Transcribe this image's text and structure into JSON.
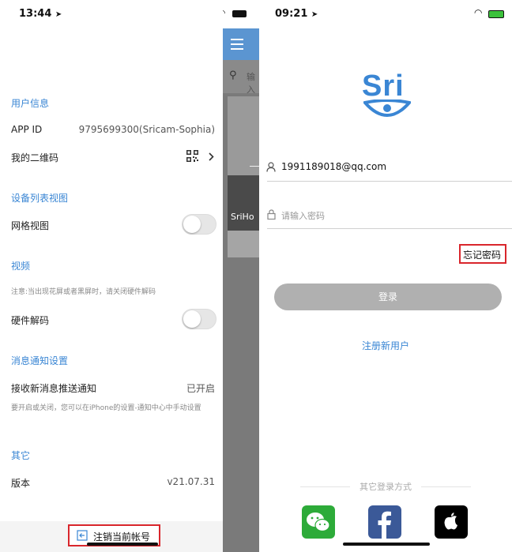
{
  "left_screen": {
    "status_time": "13:44",
    "sections": {
      "user_info": "用户信息",
      "device_list": "设备列表视图",
      "video": "视频",
      "notify": "消息通知设置",
      "other": "其它"
    },
    "rows": {
      "app_id_label": "APP ID",
      "app_id_value": "9795699300(Sricam-Sophia)",
      "qr_label": "我的二维码",
      "grid_label": "网格视图",
      "video_note": "注意:当出现花屏或者黑屏时，请关闭硬件解码",
      "hw_decode_label": "硬件解码",
      "push_label": "接收新消息推送通知",
      "push_value": "已开启",
      "push_note": "要开启或关闭，您可以在iPhone的设置-通知中心中手动设置",
      "version_label": "版本",
      "version_value": "v21.07.31"
    },
    "toggles": {
      "grid_view": false,
      "hardware_decode": false
    },
    "logout_label": "注销当前帐号"
  },
  "middle_screen": {
    "search_placeholder": "输入",
    "thumb_label": "SriHo"
  },
  "right_screen": {
    "status_time": "09:21",
    "logo_text": "Sri",
    "account_value": "1991189018@qq.com",
    "password_placeholder": "请输入密码",
    "forgot_password": "忘记密码",
    "login_button": "登录",
    "register_link": "注册新用户",
    "other_login": "其它登录方式"
  },
  "colors": {
    "accent_blue": "#3a86d4",
    "highlight_red": "#d9262c",
    "wechat_green": "#2dab39",
    "facebook_blue": "#3b5998",
    "apple_black": "#000000"
  },
  "icons": [
    "location-arrow-icon",
    "qr-code-icon",
    "chevron-right-icon",
    "logout-icon",
    "menu-icon",
    "search-icon",
    "wifi-icon",
    "battery-icon",
    "user-icon",
    "lock-icon",
    "wechat-icon",
    "facebook-icon",
    "apple-icon"
  ]
}
